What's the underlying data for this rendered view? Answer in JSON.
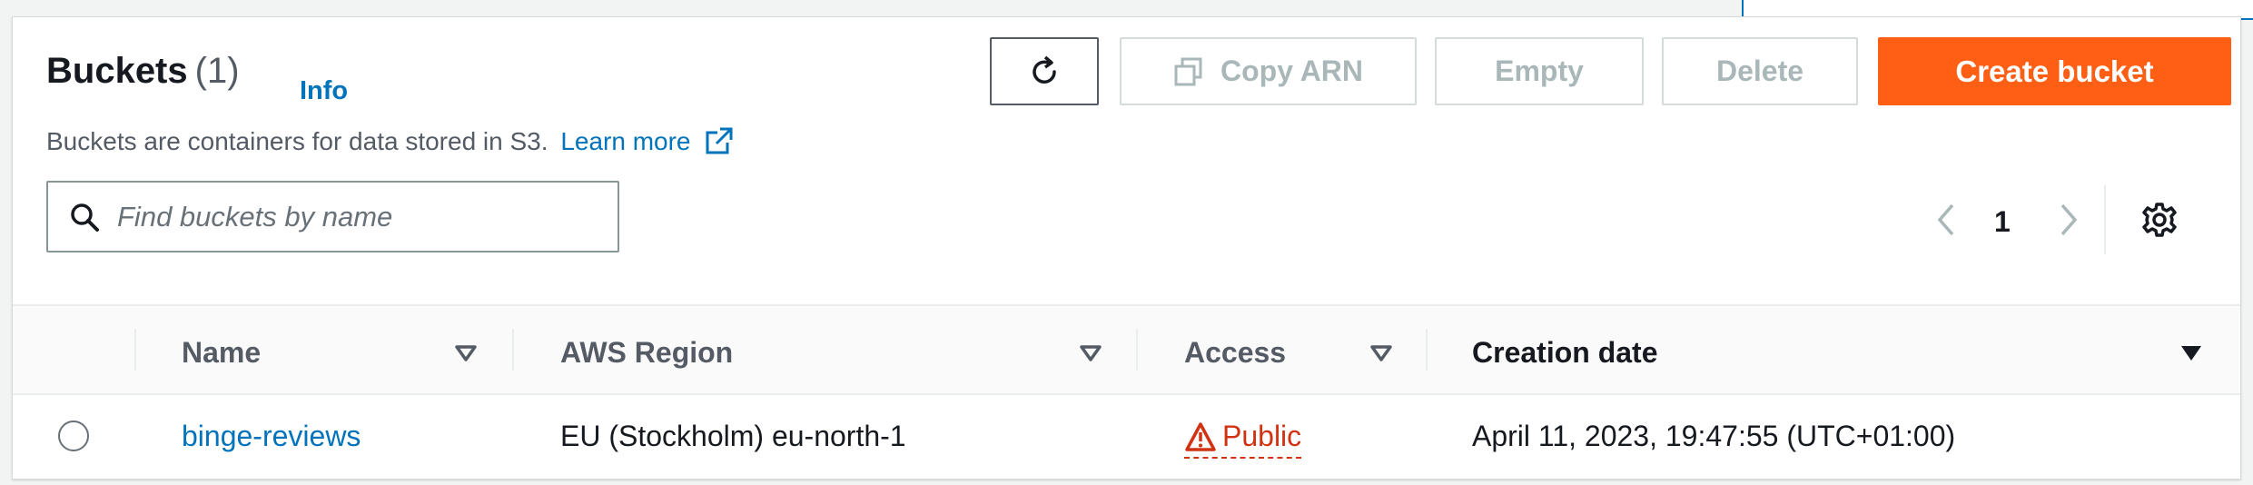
{
  "header": {
    "title": "Buckets",
    "count": "(1)",
    "info": "Info",
    "description": "Buckets are containers for data stored in S3.",
    "learn_more": "Learn more"
  },
  "toolbar": {
    "copy_arn": "Copy ARN",
    "empty": "Empty",
    "delete": "Delete",
    "create_bucket": "Create bucket"
  },
  "search": {
    "placeholder": "Find buckets by name"
  },
  "pagination": {
    "page": "1"
  },
  "table": {
    "columns": [
      "Name",
      "AWS Region",
      "Access",
      "Creation date"
    ],
    "rows": [
      {
        "name": "binge-reviews",
        "region": "EU (Stockholm) eu-north-1",
        "access": "Public",
        "created": "April 11, 2023, 19:47:55 (UTC+01:00)"
      }
    ]
  },
  "colors": {
    "primary": "#ff5f15",
    "link": "#0073bb",
    "danger": "#d13212"
  },
  "icons": [
    "refresh-icon",
    "copy-icon",
    "external-link-icon",
    "search-icon",
    "chevron-left-icon",
    "chevron-right-icon",
    "gear-icon",
    "sort-icon",
    "warning-icon"
  ]
}
